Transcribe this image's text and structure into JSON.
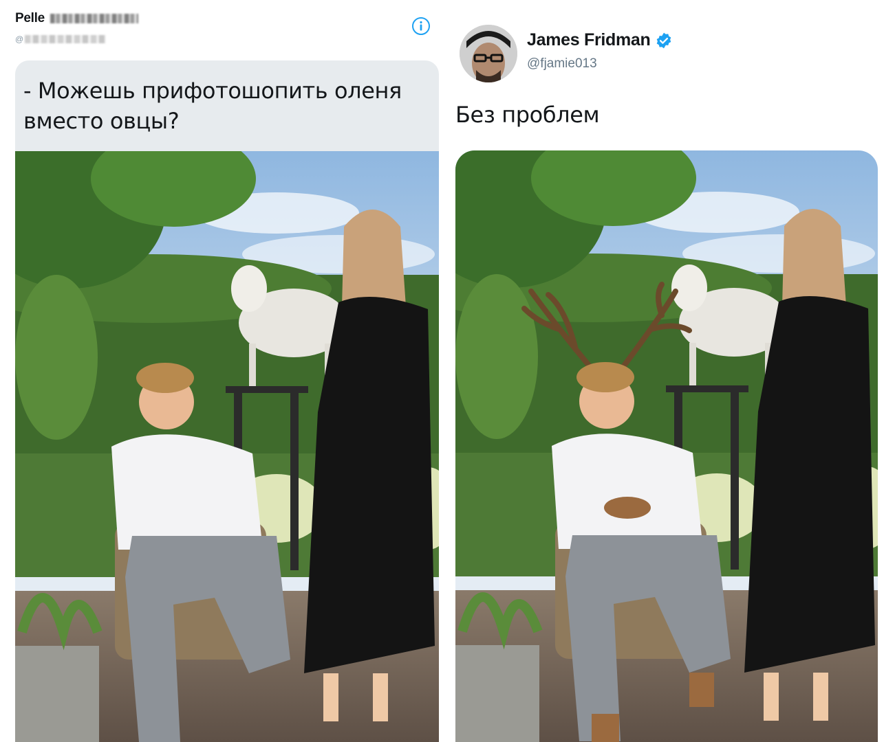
{
  "left_tweet": {
    "name": "Pelle",
    "handle_prefix": "@",
    "caption": "- Можешь прифотошопить оленя вместо овцы?",
    "photo_icon": "garden-photo-sheep-statue"
  },
  "right_tweet": {
    "name": "James Fridman",
    "handle": "@fjamie013",
    "text": "Без проблем",
    "photo_icon": "garden-photo-deer-edit"
  },
  "icons": {
    "info": "info-icon",
    "verified": "verified-badge-icon",
    "avatar": "avatar"
  },
  "colors": {
    "twitter_blue": "#1da1f2",
    "text_primary": "#14171a",
    "text_secondary": "#657786",
    "caption_bg": "#e7ebee"
  }
}
